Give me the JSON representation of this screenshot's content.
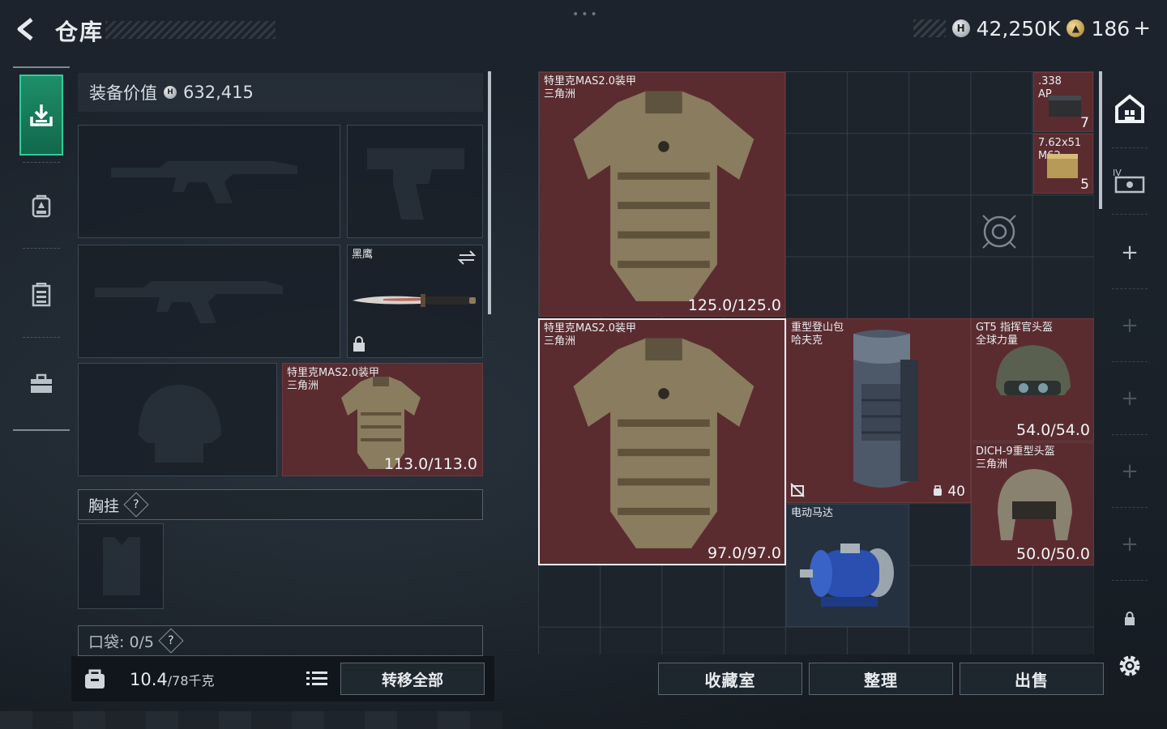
{
  "header": {
    "title": "仓库",
    "currency_silver": "42,250K",
    "currency_gold": "186",
    "currency_plus": "+"
  },
  "sidebar": {
    "items": [
      {
        "icon": "deposit-icon",
        "active": true
      },
      {
        "icon": "backpack-icon",
        "active": false
      },
      {
        "icon": "vest-icon",
        "active": false
      },
      {
        "icon": "briefcase-icon",
        "active": false
      }
    ]
  },
  "equipment": {
    "value_label": "装备价值",
    "value": "632,415",
    "knife_name": "黑鹰",
    "armor_name_line1": "特里克MAS2.0装甲",
    "armor_name_line2": "三角洲",
    "armor_durability": "113.0/113.0",
    "chest_rig_label": "胸挂",
    "pocket_label": "口袋: 0/5",
    "help_mark": "?",
    "weight": "10.4",
    "weight_unit": "/78千克",
    "transfer_all": "转移全部"
  },
  "warehouse": {
    "items": [
      {
        "name1": "特里克MAS2.0装甲",
        "name2": "三角洲",
        "value": "125.0/125.0"
      },
      {
        "name1": ".338",
        "name2": "AP",
        "count": "7"
      },
      {
        "name1": "7.62x51",
        "name2": "M62",
        "count": "5"
      },
      {
        "name1": "特里克MAS2.0装甲",
        "name2": "三角洲",
        "value": "97.0/97.0"
      },
      {
        "name1": "重型登山包",
        "name2": "哈夫克",
        "capacity": "40"
      },
      {
        "name1": "GT5 指挥官头盔",
        "name2": "全球力量",
        "value": "54.0/54.0"
      },
      {
        "name1": "DICH-9重型头盔",
        "name2": "三角洲",
        "value": "50.0/50.0"
      },
      {
        "name1": "电动马达"
      }
    ]
  },
  "actions": {
    "collection": "收藏室",
    "organize": "整理",
    "sell": "出售"
  },
  "colors": {
    "accent_green": "#1d8f69",
    "item_red": "#5a2c30"
  }
}
